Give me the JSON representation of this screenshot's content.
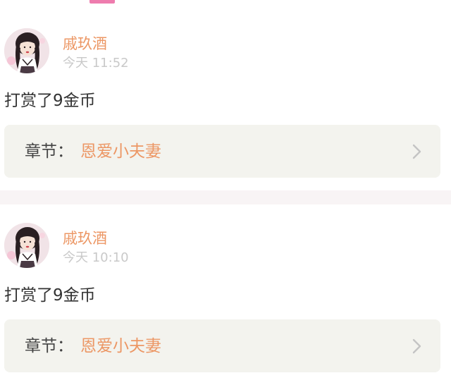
{
  "entries": [
    {
      "username": "戚玖酒",
      "time": "今天 11:52",
      "message": "打赏了9金币",
      "chapter_label": "章节：",
      "chapter_title": "恩爱小夫妻"
    },
    {
      "username": "戚玖酒",
      "time": "今天 10:10",
      "message": "打赏了9金币",
      "chapter_label": "章节：",
      "chapter_title": "恩爱小夫妻"
    }
  ],
  "colors": {
    "accent_pink": "#ee7cae",
    "username_orange": "#ec9765",
    "card_background": "#f3f3ee",
    "separator": "#f8f4f5"
  },
  "icons": {
    "chevron": "chevron-right-icon",
    "avatar": "user-avatar"
  }
}
